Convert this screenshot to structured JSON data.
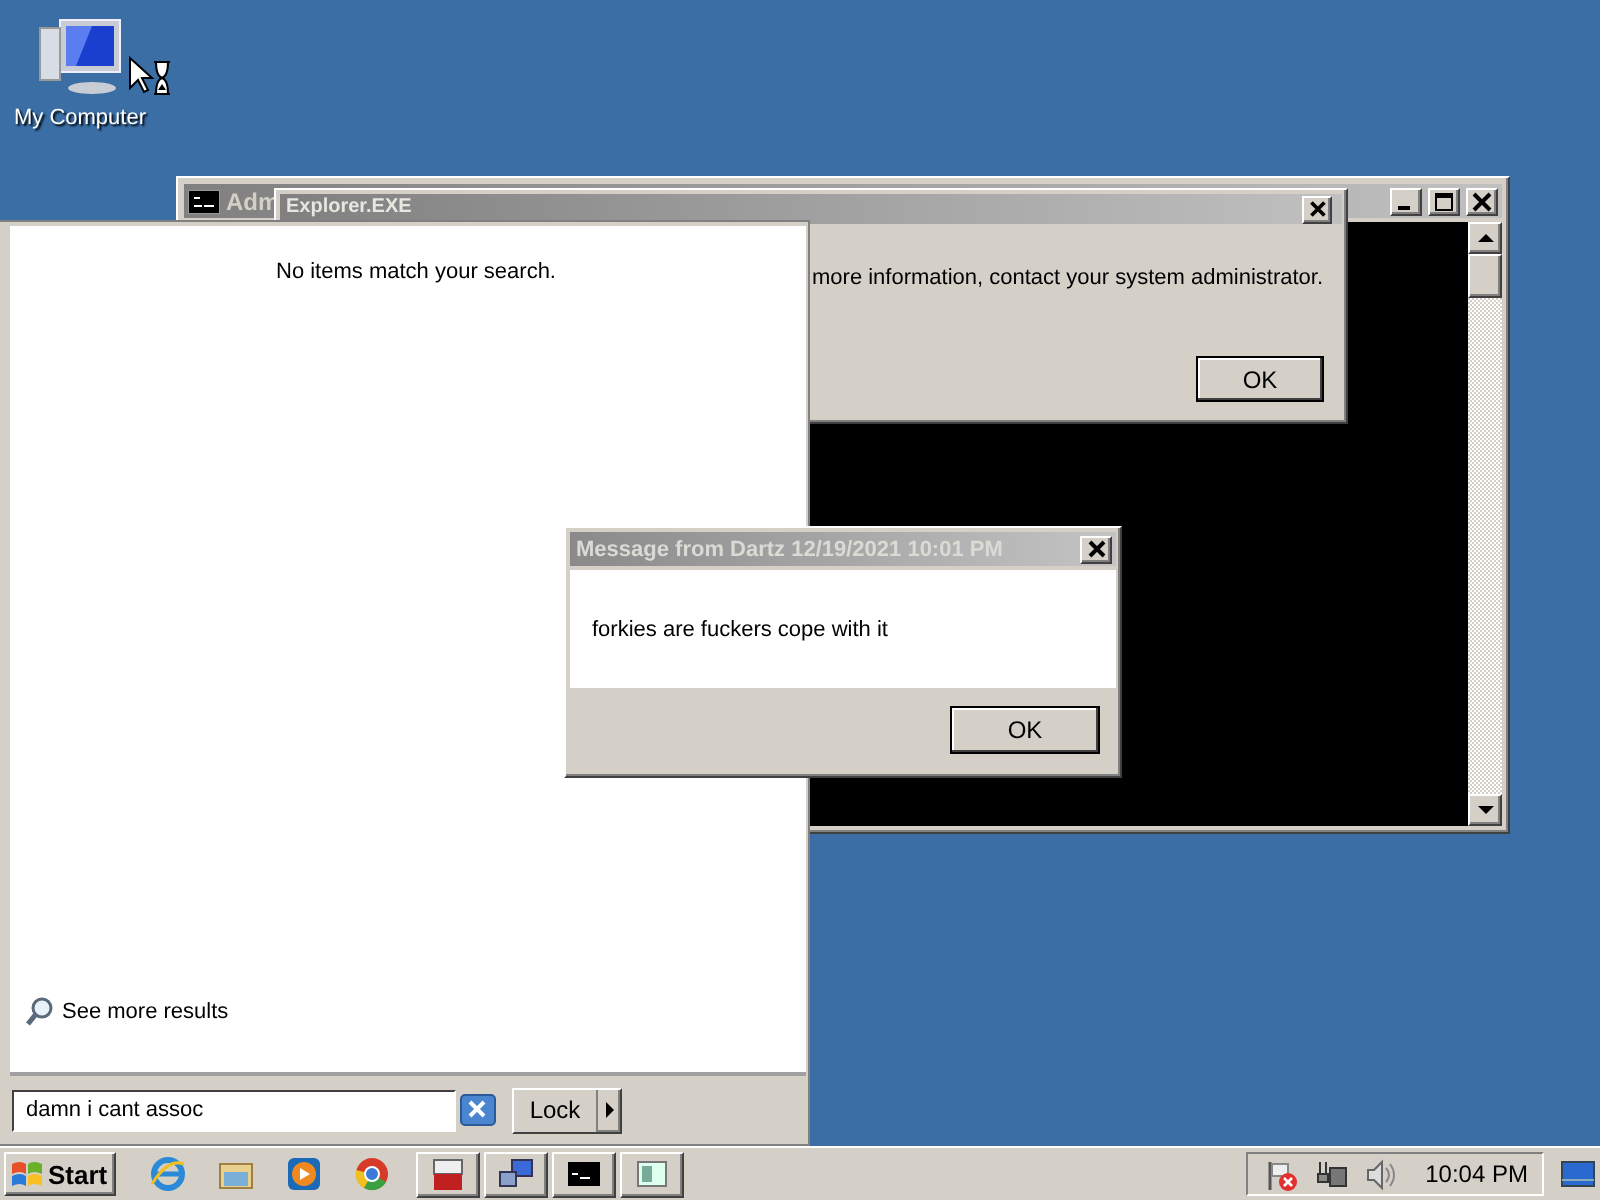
{
  "desktop": {
    "icons": [
      {
        "label": "My Computer"
      }
    ]
  },
  "console_window": {
    "title": "Adm"
  },
  "error_dialog": {
    "title": "Explorer.EXE",
    "message": "more information, contact your system administrator.",
    "button": "OK"
  },
  "message_dialog": {
    "title": "Message from Dartz 12/19/2021 10:01 PM",
    "message": "forkies are fuckers cope with it",
    "button": "OK"
  },
  "start_menu": {
    "empty_text": "No items match your search.",
    "more_results": "See more results",
    "search": {
      "value": "damn i cant assoc"
    },
    "power_button": "Lock"
  },
  "taskbar": {
    "start_label": "Start",
    "clock": "10:04 PM"
  }
}
